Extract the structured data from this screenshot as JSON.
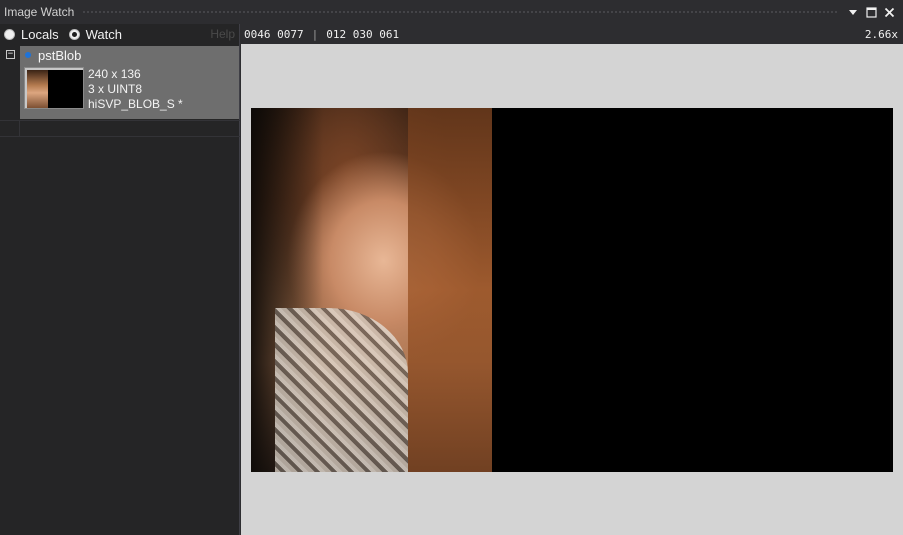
{
  "window": {
    "title": "Image Watch",
    "controls": [
      "dropdown-icon",
      "maximize-icon",
      "close-icon"
    ]
  },
  "modebar": {
    "locals_label": "Locals",
    "watch_label": "Watch",
    "help_label": "Help",
    "selected": "Watch"
  },
  "watch_items": [
    {
      "name": "pstBlob",
      "size": "240 x 136",
      "type": "3 x UINT8",
      "struct": "hiSVP_BLOB_S *"
    }
  ],
  "infobar": {
    "coords": "0046 0077",
    "separator": "|",
    "pixel_value": "012 030 061",
    "zoom": "2.66x"
  },
  "colors": {
    "panel_bg": "#252526",
    "selected_item_bg": "#6e6e6e",
    "viewport_bg": "#d4d4d4",
    "accent_dot": "#1e73d8"
  }
}
